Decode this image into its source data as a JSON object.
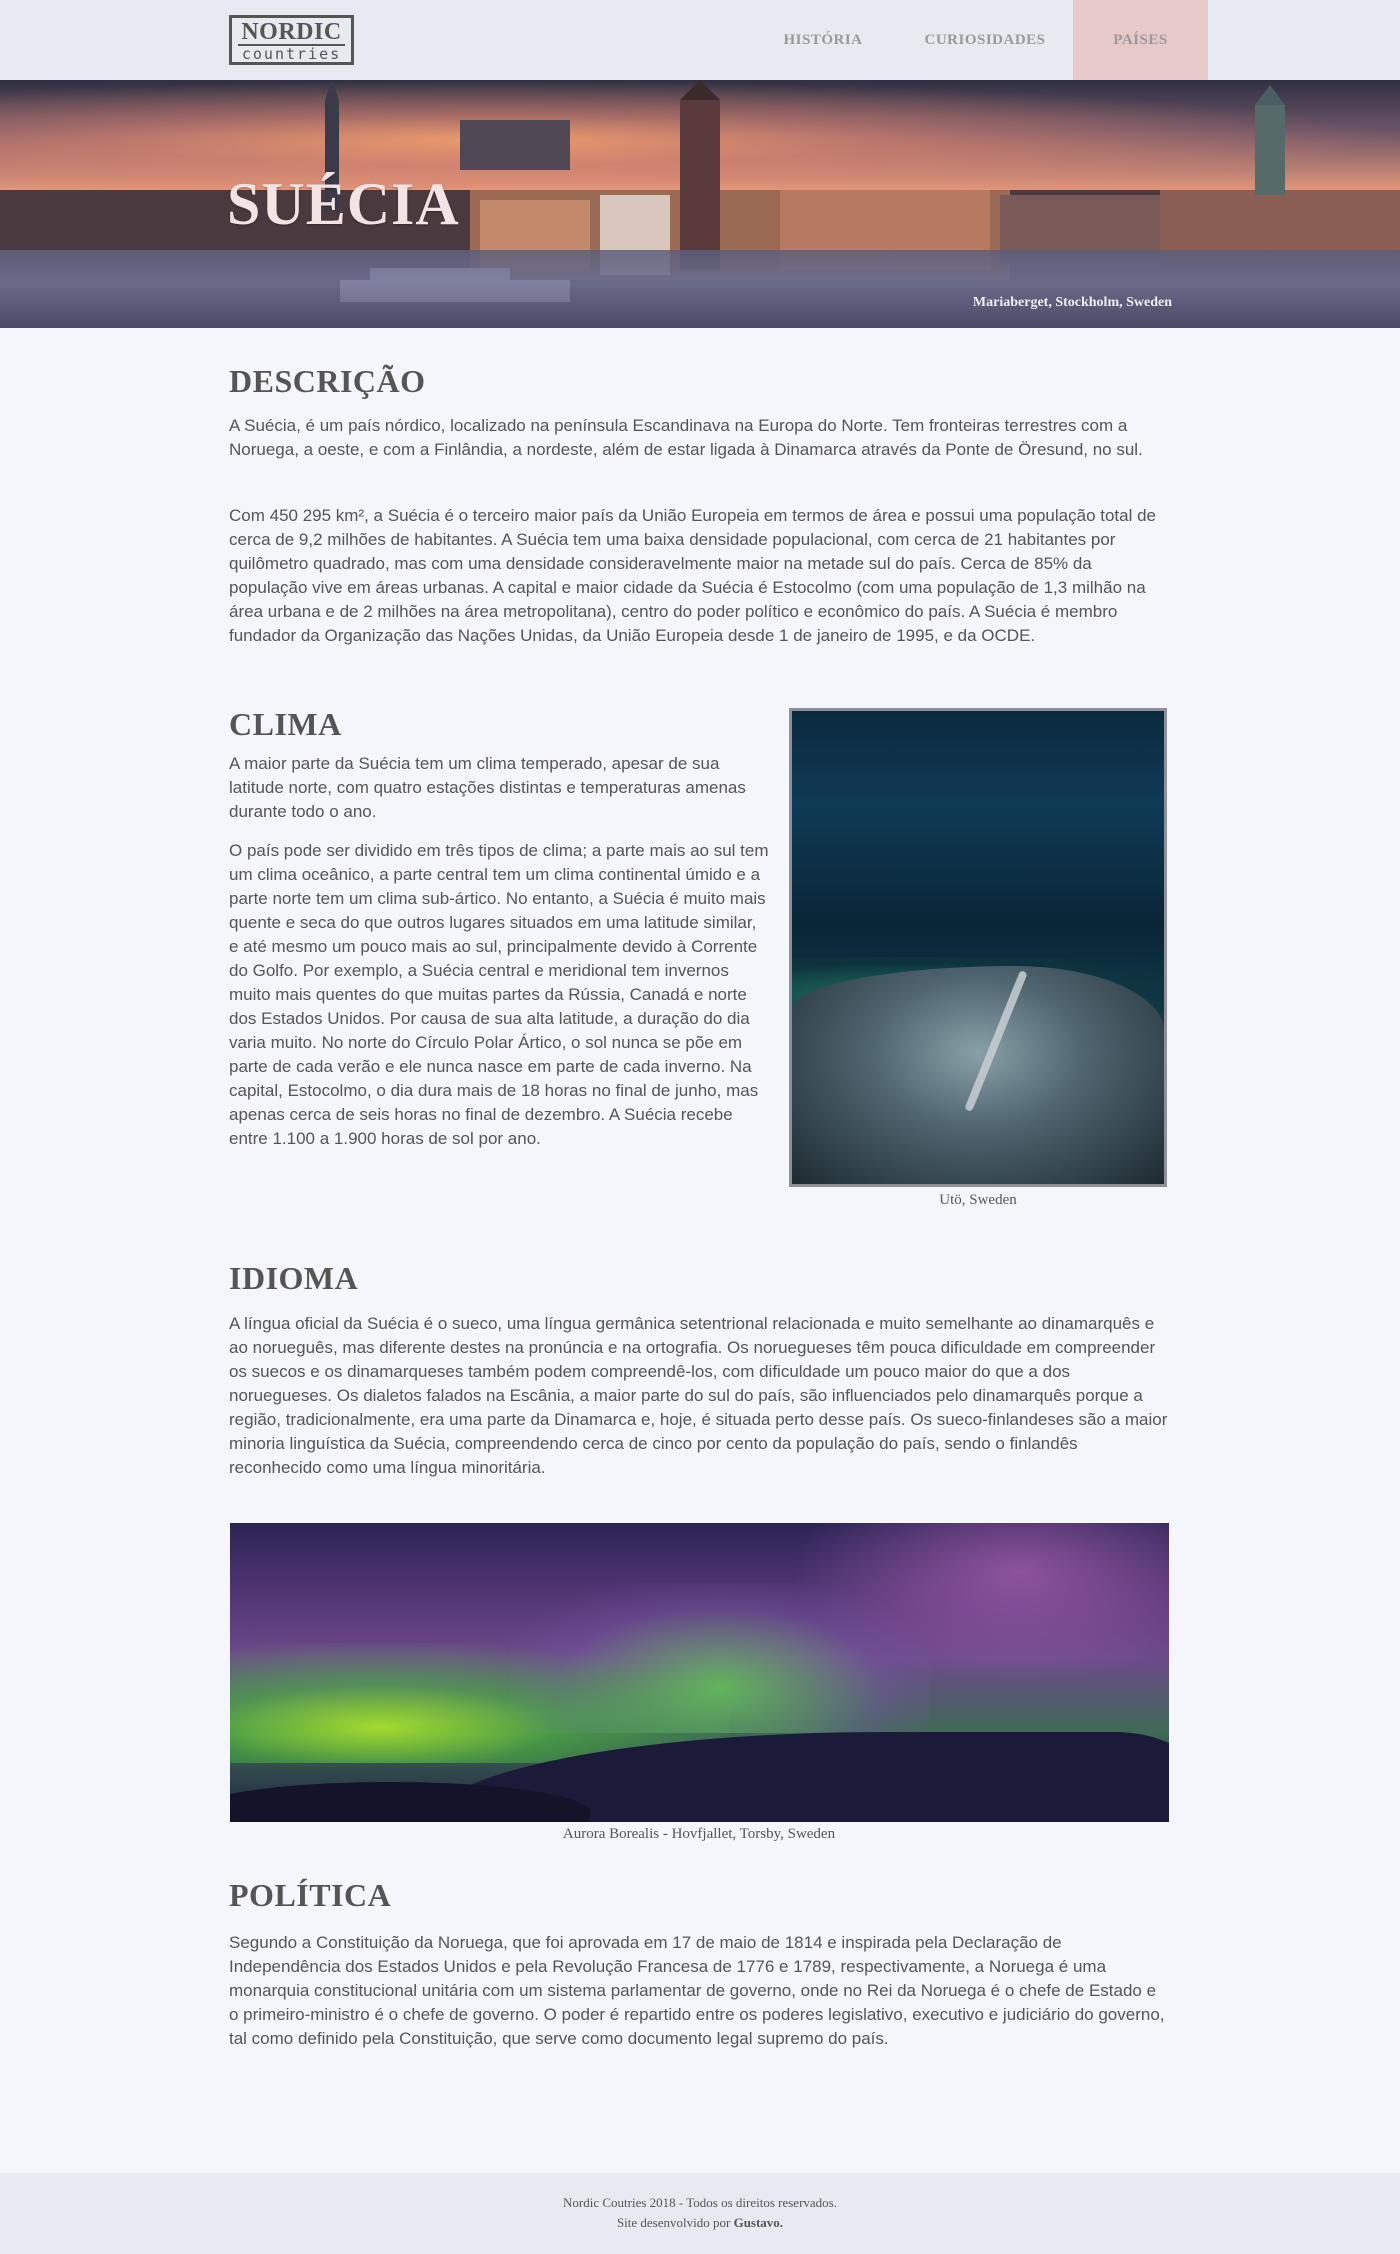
{
  "header": {
    "logo_top": "NORDIC",
    "logo_bottom": "countries",
    "nav": [
      "HISTÓRIA",
      "CURIOSIDADES",
      "PAÍSES"
    ]
  },
  "hero": {
    "title": "SUÉCIA",
    "caption": "Mariaberget, Stockholm, Sweden"
  },
  "descricao": {
    "title": "DESCRIÇÃO",
    "p1": "A Suécia, é um país nórdico, localizado na península Escandinava na Europa do Norte. Tem fronteiras terrestres com a Noruega, a oeste, e com a Finlândia, a nordeste, além de estar ligada à Dinamarca através da Ponte de Öresund, no sul.",
    "p2": "Com 450 295 km², a Suécia é o terceiro maior país da União Europeia em termos de área e possui uma população total de cerca de 9,2 milhões de habitantes. A Suécia tem uma baixa densidade populacional, com cerca de 21 habitantes por quilômetro quadrado, mas com uma densidade consideravelmente maior na metade sul do país. Cerca de 85% da população vive em áreas urbanas. A capital e maior cidade da Suécia é Estocolmo (com uma população de 1,3 milhão na área urbana e de 2 milhões na área metropolitana), centro do poder político e econômico do país. A Suécia é membro fundador da Organização das Nações Unidas, da União Europeia desde 1 de janeiro de 1995, e da OCDE."
  },
  "clima": {
    "title": "CLIMA",
    "p1": "A maior parte da Suécia tem um clima temperado, apesar de sua latitude norte, com quatro estações distintas e temperaturas amenas durante todo o ano.",
    "p2": "O país pode ser dividido em três tipos de clima; a parte mais ao sul tem um clima oceânico, a parte central tem um clima continental úmido e a parte norte tem um clima sub-ártico. No entanto, a Suécia é muito mais quente e seca do que outros lugares situados em uma latitude similar, e até mesmo um pouco mais ao sul, principalmente devido à Corrente do Golfo. Por exemplo, a Suécia central e meridional tem invernos muito mais quentes do que muitas partes da Rússia, Canadá e norte dos Estados Unidos. Por causa de sua alta latitude, a duração do dia varia muito. No norte do Círculo Polar Ártico, o sol nunca se põe em parte de cada verão e ele nunca nasce em parte de cada inverno. Na capital, Estocolmo, o dia dura mais de 18 horas no final de junho, mas apenas cerca de seis horas no final de dezembro. A Suécia recebe entre 1.100 a 1.900 horas de sol por ano.",
    "image_caption": "Utö, Sweden"
  },
  "idioma": {
    "title": "IDIOMA",
    "p": "A língua oficial da Suécia é o sueco, uma língua germânica setentrional relacionada e muito semelhante ao dinamarquês e ao norueguês, mas diferente destes na pronúncia e na ortografia. Os noruegueses têm pouca dificuldade em compreender os suecos e os dinamarqueses também podem compreendê-los, com dificuldade um pouco maior do que a dos noruegueses. Os dialetos falados na Escânia, a maior parte do sul do país, são influenciados pelo dinamarquês porque a região, tradicionalmente, era uma parte da Dinamarca e, hoje, é situada perto desse país. Os sueco-finlandeses são a maior minoria linguística da Suécia, compreendendo cerca de cinco por cento da população do país, sendo o finlandês reconhecido como uma língua minoritária."
  },
  "aurora": {
    "caption": "Aurora Borealis - Hovfjallet, Torsby, Sweden"
  },
  "politica": {
    "title": "POLÍTICA",
    "p": "Segundo a Constituição da Noruega, que foi aprovada em 17 de maio de 1814 e inspirada pela Declaração de Independência dos Estados Unidos e pela Revolução Francesa de 1776 e 1789, respectivamente, a Noruega é uma monarquia constitucional unitária com um sistema parlamentar de governo, onde no Rei da Noruega é o chefe de Estado e o primeiro-ministro é o chefe de governo. O poder é repartido entre os poderes legislativo, executivo e judiciário do governo, tal como definido pela Constituição, que serve como documento legal supremo do país."
  },
  "footer": {
    "line1": "Nordic Coutries 2018 - Todos os direitos reservados.",
    "line2_prefix": "Site desenvolvido por ",
    "line2_author": "Gustavo."
  }
}
